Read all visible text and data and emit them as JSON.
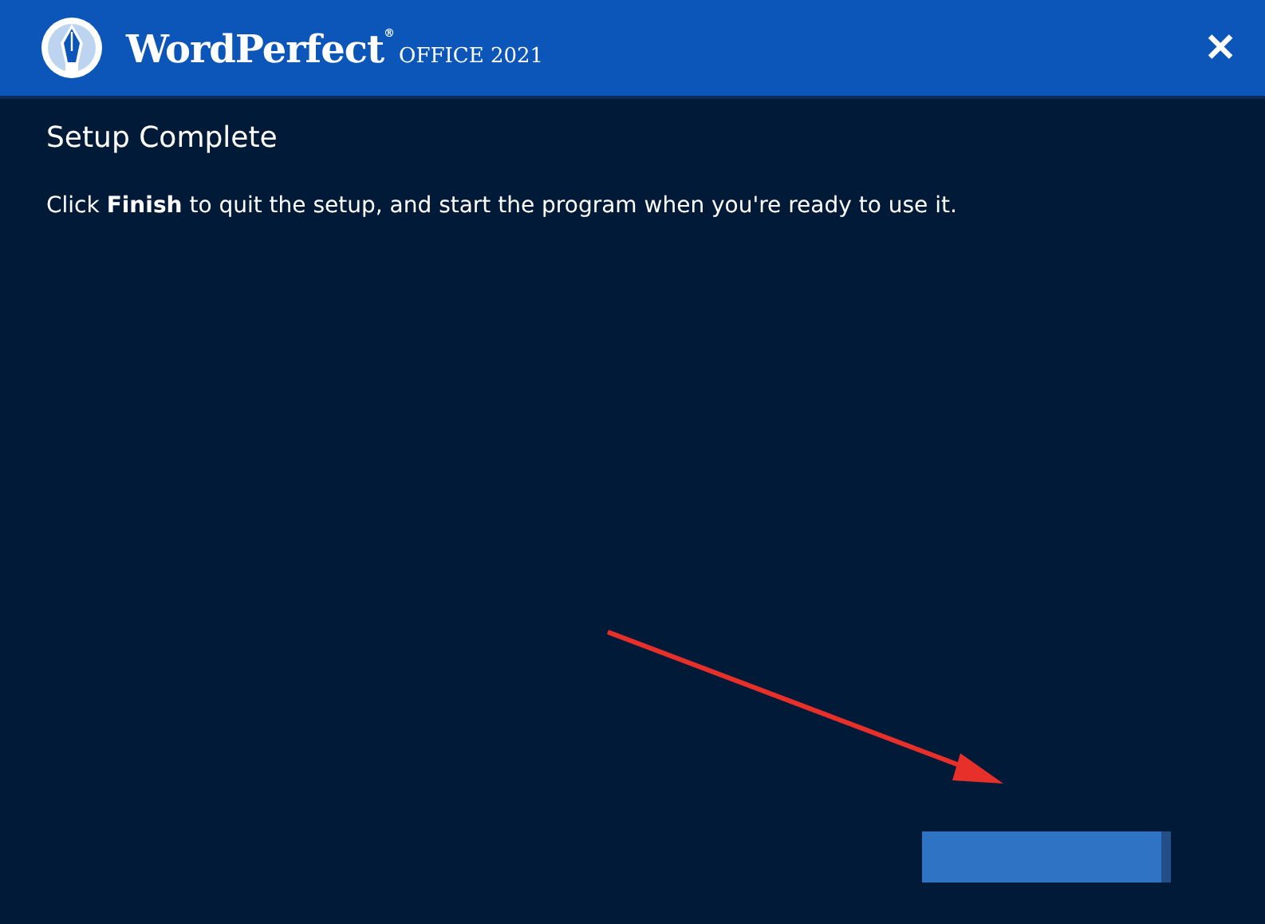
{
  "window": {
    "brand": "WordPerfect$^{®}$",
    "product": "OFFICE 2021",
    "close": "✕"
  },
  "page": {
    "heading": "Setup Complete",
    "message": "Click **Finish** to quit the setup, and start the program when you're ready to use it."
  },
  "annotation": {
    "kind": "arrow"
  },
  "footer": {
    "button": {
      "kind": "primary"
    }
  }
}
